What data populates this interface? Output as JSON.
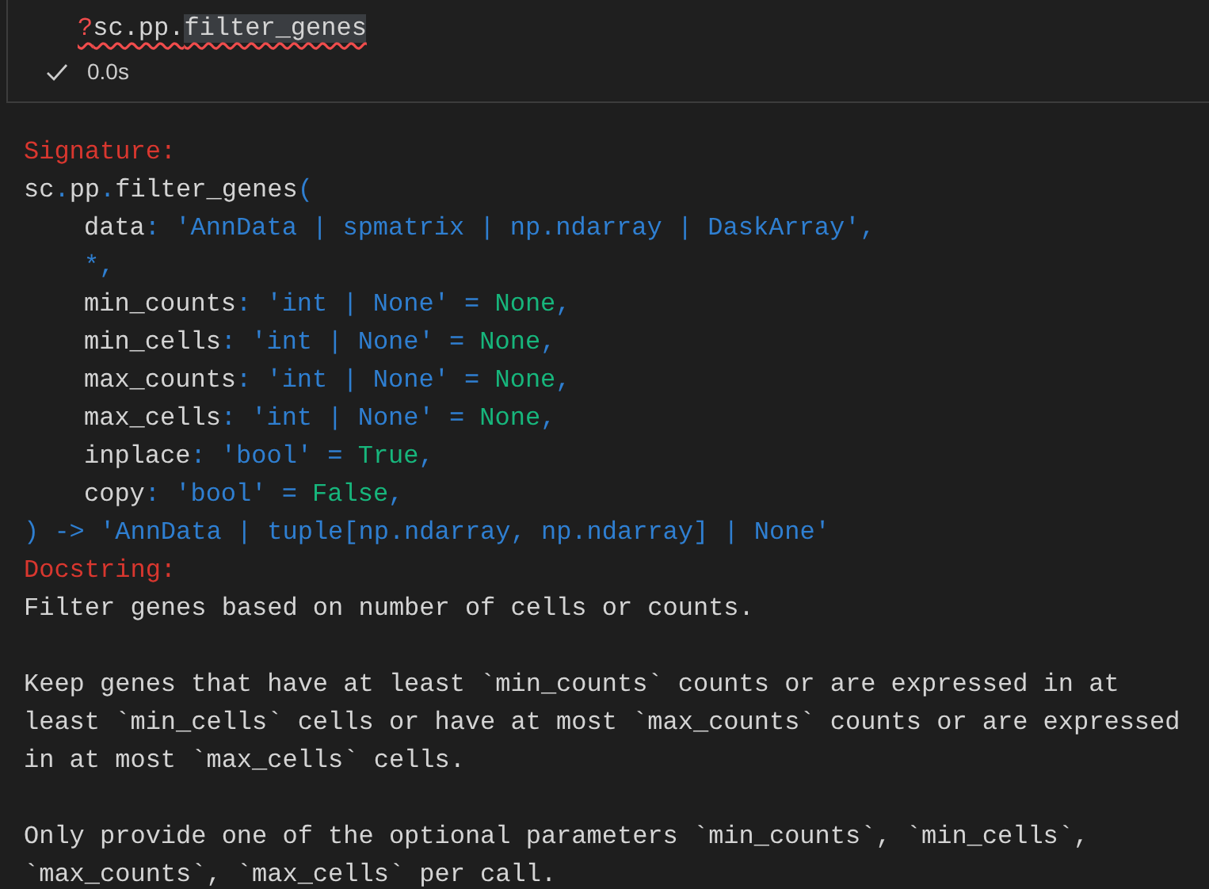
{
  "input_cell": {
    "error": true,
    "segments": [
      {
        "text": "?",
        "kind": "operator"
      },
      {
        "text": "sc.pp.",
        "kind": "plain"
      },
      {
        "text": "filter_genes",
        "kind": "highlighted"
      }
    ],
    "succeeded": true,
    "duration": "0.0s"
  },
  "signature": {
    "heading": "Signature:",
    "lines": [
      {
        "segments": [
          {
            "text": "sc",
            "kind": "plain"
          },
          {
            "text": ".",
            "kind": "punct"
          },
          {
            "text": "pp",
            "kind": "plain"
          },
          {
            "text": ".",
            "kind": "punct"
          },
          {
            "text": "filter_genes",
            "kind": "plain"
          },
          {
            "text": "(",
            "kind": "punct"
          }
        ],
        "children": [
          {
            "segments": [
              {
                "text": "data",
                "kind": "plain"
              },
              {
                "text": ": ",
                "kind": "punct"
              },
              {
                "text": "'AnnData | spmatrix | np.ndarray | DaskArray'",
                "kind": "string"
              },
              {
                "text": ",",
                "kind": "punct"
              }
            ]
          },
          {
            "segments": [
              {
                "text": "*,",
                "kind": "punct"
              }
            ]
          },
          {
            "segments": [
              {
                "text": "min_counts",
                "kind": "plain"
              },
              {
                "text": ": ",
                "kind": "punct"
              },
              {
                "text": "'int | None'",
                "kind": "string"
              },
              {
                "text": " = ",
                "kind": "punct"
              },
              {
                "text": "None",
                "kind": "value"
              },
              {
                "text": ",",
                "kind": "punct"
              }
            ]
          },
          {
            "segments": [
              {
                "text": "min_cells",
                "kind": "plain"
              },
              {
                "text": ": ",
                "kind": "punct"
              },
              {
                "text": "'int | None'",
                "kind": "string"
              },
              {
                "text": " = ",
                "kind": "punct"
              },
              {
                "text": "None",
                "kind": "value"
              },
              {
                "text": ",",
                "kind": "punct"
              }
            ]
          },
          {
            "segments": [
              {
                "text": "max_counts",
                "kind": "plain"
              },
              {
                "text": ": ",
                "kind": "punct"
              },
              {
                "text": "'int | None'",
                "kind": "string"
              },
              {
                "text": " = ",
                "kind": "punct"
              },
              {
                "text": "None",
                "kind": "value"
              },
              {
                "text": ",",
                "kind": "punct"
              }
            ]
          },
          {
            "segments": [
              {
                "text": "max_cells",
                "kind": "plain"
              },
              {
                "text": ": ",
                "kind": "punct"
              },
              {
                "text": "'int | None'",
                "kind": "string"
              },
              {
                "text": " = ",
                "kind": "punct"
              },
              {
                "text": "None",
                "kind": "value"
              },
              {
                "text": ",",
                "kind": "punct"
              }
            ]
          },
          {
            "segments": [
              {
                "text": "inplace",
                "kind": "plain"
              },
              {
                "text": ": ",
                "kind": "punct"
              },
              {
                "text": "'bool'",
                "kind": "string"
              },
              {
                "text": " = ",
                "kind": "punct"
              },
              {
                "text": "True",
                "kind": "value"
              },
              {
                "text": ",",
                "kind": "punct"
              }
            ]
          },
          {
            "segments": [
              {
                "text": "copy",
                "kind": "plain"
              },
              {
                "text": ": ",
                "kind": "punct"
              },
              {
                "text": "'bool'",
                "kind": "string"
              },
              {
                "text": " = ",
                "kind": "punct"
              },
              {
                "text": "False",
                "kind": "value"
              },
              {
                "text": ",",
                "kind": "punct"
              }
            ]
          }
        ]
      },
      {
        "segments": [
          {
            "text": ") -> ",
            "kind": "punct"
          },
          {
            "text": "'AnnData | tuple[np.ndarray, np.ndarray] | None'",
            "kind": "string"
          }
        ]
      }
    ]
  },
  "docstring": {
    "heading": "Docstring:",
    "paragraphs": [
      [
        "Filter genes based on number of cells or counts."
      ],
      [
        "Keep genes that have at least `min_counts` counts or are expressed in at",
        "least `min_cells` cells or have at most `max_counts` counts or are expressed",
        "in at most `max_cells` cells."
      ],
      [
        "Only provide one of the optional parameters `min_counts`, `min_cells`,",
        "`max_counts`, `max_cells` per call."
      ]
    ]
  }
}
